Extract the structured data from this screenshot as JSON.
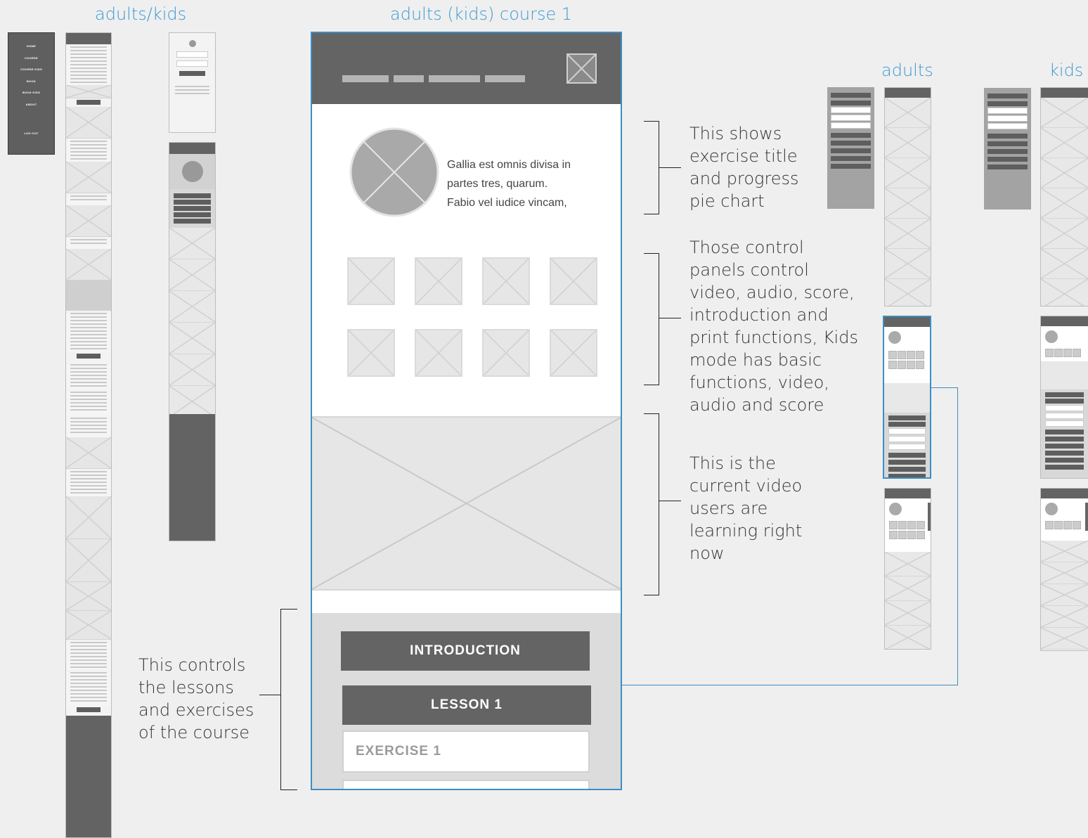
{
  "titles": {
    "adults_kids": "adults/kids",
    "course": "adults (kids)  course 1",
    "adults": "adults",
    "kids": "kids"
  },
  "nav_menu": {
    "items": [
      "HOME",
      "COURSE",
      "COURSE KIDS",
      "BOOK",
      "BOOK KIDS",
      "ABOUT",
      "LOG OUT"
    ]
  },
  "phone": {
    "description_text": [
      "Gallia est omnis divisa in",
      "partes tres, quarum.",
      "Fabio vel iudice vincam,"
    ],
    "menu": {
      "introduction": "INTRODUCTION",
      "lesson1": "LESSON 1",
      "exercise1": "EXERCISE 1"
    }
  },
  "annotations": {
    "title_progress": [
      "This shows",
      "exercise title",
      "and progress",
      "pie chart"
    ],
    "control_panels": [
      "Those control",
      "panels control",
      "video, audio, score,",
      "introduction and",
      "print functions, Kids",
      "mode has basic",
      "functions, video,",
      "audio and score"
    ],
    "current_video": [
      "This is the",
      "current video",
      "users are",
      "learning right",
      "now"
    ],
    "lessons": [
      "This controls",
      "the lessons",
      "and exercises",
      "of the course"
    ]
  },
  "colors": {
    "accent": "#3d9ad1",
    "header_gray": "#646464",
    "placeholder": "#e6e6e6"
  }
}
